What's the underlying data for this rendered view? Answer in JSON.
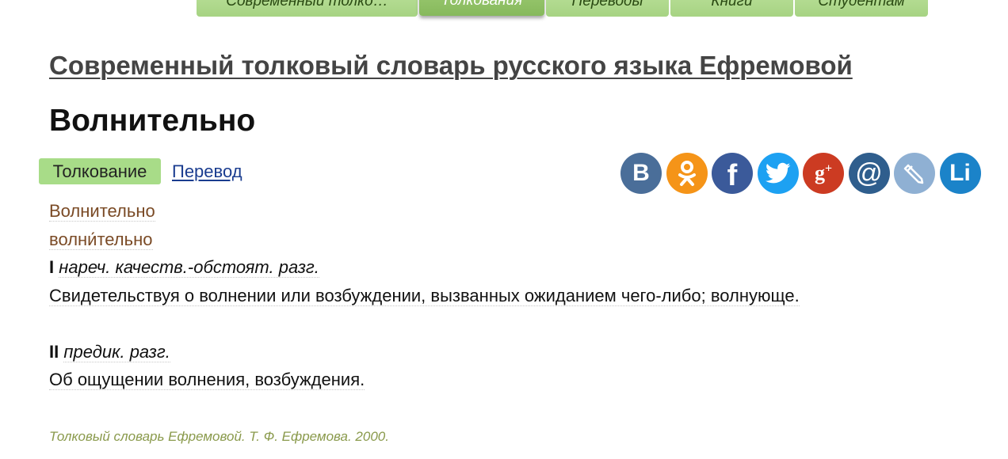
{
  "tabs": [
    {
      "label": "Современный толко…",
      "active": false
    },
    {
      "label": "Толкования",
      "active": true
    },
    {
      "label": "Переводы",
      "active": false
    },
    {
      "label": "Книги",
      "active": false
    },
    {
      "label": "Студентам",
      "active": false
    }
  ],
  "dictionary_title": "Современный толковый словарь русского языка Ефремовой",
  "word": "Волнительно",
  "subtabs": {
    "active": "Толкование",
    "link": "Перевод"
  },
  "social": [
    {
      "name": "vk",
      "glyph": "В",
      "color": "#4a6e99"
    },
    {
      "name": "odnoklassniki",
      "glyph": "ok",
      "color": "#f59418"
    },
    {
      "name": "facebook",
      "glyph": "f",
      "color": "#3b5a9a"
    },
    {
      "name": "twitter",
      "glyph": "bird",
      "color": "#1da1f2"
    },
    {
      "name": "google-plus",
      "glyph": "g+",
      "color": "#cc3b22"
    },
    {
      "name": "mail",
      "glyph": "@",
      "color": "#2f5e8d"
    },
    {
      "name": "livejournal",
      "glyph": "pencil",
      "color": "#8fb0d3"
    },
    {
      "name": "liveinternet",
      "glyph": "Li",
      "color": "#1b83c9"
    }
  ],
  "entry": {
    "headword": "Волнительно",
    "stressed": "волни́тельно",
    "sense1": {
      "numeral": "I",
      "grammar": "нареч. качеств.-обстоят. разг.",
      "definition": "Свидетельствуя о волнении или возбуждении, вызванных ожиданием чего-либо; волнующе."
    },
    "sense2": {
      "numeral": "II",
      "grammar": "предик. разг.",
      "definition": "Об ощущении волнения, возбуждения."
    }
  },
  "source": "Толковый словарь Ефремовой. Т. Ф. Ефремова. 2000."
}
